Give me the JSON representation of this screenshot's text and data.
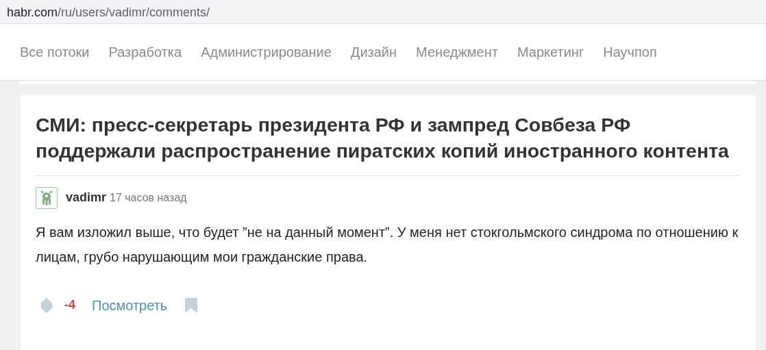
{
  "address_bar": {
    "domain": "habr.com",
    "path": "/ru/users/vadimr/comments/"
  },
  "nav": [
    {
      "label": "Все потоки"
    },
    {
      "label": "Разработка"
    },
    {
      "label": "Администрирование"
    },
    {
      "label": "Дизайн"
    },
    {
      "label": "Менеджмент"
    },
    {
      "label": "Маркетинг"
    },
    {
      "label": "Научпоп"
    }
  ],
  "post": {
    "title": "СМИ: пресс-секретарь президента РФ и зампред Совбеза РФ поддержали распространение пиратских копий иностранного контента"
  },
  "comment": {
    "author": "vadimr",
    "time": "17 часов назад",
    "text": "Я вам изложил выше, что будет ”не на данный момент”. У меня нет стокгольмского синдрома по отношению к лицам, грубо нарушающим мои гражданские права.",
    "score": "-4",
    "negative": true,
    "link": "Посмотреть"
  }
}
